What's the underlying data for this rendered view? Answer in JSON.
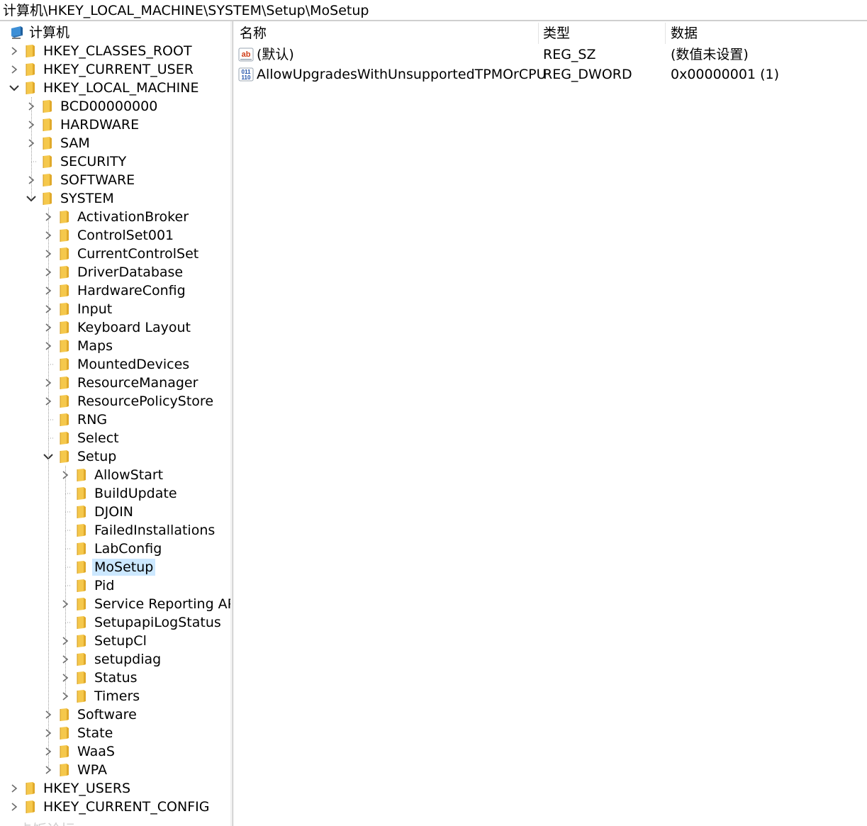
{
  "address_bar": {
    "path": "计算机\\HKEY_LOCAL_MACHINE\\SYSTEM\\Setup\\MoSetup"
  },
  "tree": {
    "root_label": "计算机",
    "items": [
      {
        "label": "HKEY_CLASSES_ROOT",
        "level": 1,
        "expander": "collapsed"
      },
      {
        "label": "HKEY_CURRENT_USER",
        "level": 1,
        "expander": "collapsed"
      },
      {
        "label": "HKEY_LOCAL_MACHINE",
        "level": 1,
        "expander": "expanded"
      },
      {
        "label": "BCD00000000",
        "level": 2,
        "expander": "collapsed"
      },
      {
        "label": "HARDWARE",
        "level": 2,
        "expander": "collapsed"
      },
      {
        "label": "SAM",
        "level": 2,
        "expander": "collapsed"
      },
      {
        "label": "SECURITY",
        "level": 2,
        "expander": "none"
      },
      {
        "label": "SOFTWARE",
        "level": 2,
        "expander": "collapsed"
      },
      {
        "label": "SYSTEM",
        "level": 2,
        "expander": "expanded"
      },
      {
        "label": "ActivationBroker",
        "level": 3,
        "expander": "collapsed"
      },
      {
        "label": "ControlSet001",
        "level": 3,
        "expander": "collapsed"
      },
      {
        "label": "CurrentControlSet",
        "level": 3,
        "expander": "collapsed"
      },
      {
        "label": "DriverDatabase",
        "level": 3,
        "expander": "collapsed"
      },
      {
        "label": "HardwareConfig",
        "level": 3,
        "expander": "collapsed"
      },
      {
        "label": "Input",
        "level": 3,
        "expander": "collapsed"
      },
      {
        "label": "Keyboard Layout",
        "level": 3,
        "expander": "collapsed"
      },
      {
        "label": "Maps",
        "level": 3,
        "expander": "collapsed"
      },
      {
        "label": "MountedDevices",
        "level": 3,
        "expander": "none"
      },
      {
        "label": "ResourceManager",
        "level": 3,
        "expander": "collapsed"
      },
      {
        "label": "ResourcePolicyStore",
        "level": 3,
        "expander": "collapsed"
      },
      {
        "label": "RNG",
        "level": 3,
        "expander": "none"
      },
      {
        "label": "Select",
        "level": 3,
        "expander": "none"
      },
      {
        "label": "Setup",
        "level": 3,
        "expander": "expanded"
      },
      {
        "label": "AllowStart",
        "level": 4,
        "expander": "collapsed"
      },
      {
        "label": "BuildUpdate",
        "level": 4,
        "expander": "none"
      },
      {
        "label": "DJOIN",
        "level": 4,
        "expander": "none"
      },
      {
        "label": "FailedInstallations",
        "level": 4,
        "expander": "none"
      },
      {
        "label": "LabConfig",
        "level": 4,
        "expander": "none"
      },
      {
        "label": "MoSetup",
        "level": 4,
        "expander": "none",
        "selected": true
      },
      {
        "label": "Pid",
        "level": 4,
        "expander": "none"
      },
      {
        "label": "Service Reporting API",
        "level": 4,
        "expander": "collapsed"
      },
      {
        "label": "SetupapiLogStatus",
        "level": 4,
        "expander": "none"
      },
      {
        "label": "SetupCl",
        "level": 4,
        "expander": "collapsed"
      },
      {
        "label": "setupdiag",
        "level": 4,
        "expander": "collapsed"
      },
      {
        "label": "Status",
        "level": 4,
        "expander": "collapsed"
      },
      {
        "label": "Timers",
        "level": 4,
        "expander": "collapsed"
      },
      {
        "label": "Software",
        "level": 3,
        "expander": "collapsed"
      },
      {
        "label": "State",
        "level": 3,
        "expander": "collapsed"
      },
      {
        "label": "WaaS",
        "level": 3,
        "expander": "collapsed"
      },
      {
        "label": "WPA",
        "level": 3,
        "expander": "collapsed"
      },
      {
        "label": "HKEY_USERS",
        "level": 1,
        "expander": "collapsed"
      },
      {
        "label": "HKEY_CURRENT_CONFIG",
        "level": 1,
        "expander": "collapsed"
      }
    ]
  },
  "list": {
    "columns": {
      "name": "名称",
      "type": "类型",
      "data": "数据"
    },
    "rows": [
      {
        "icon": "string-value-icon",
        "name": "(默认)",
        "type": "REG_SZ",
        "data": "(数值未设置)"
      },
      {
        "icon": "binary-value-icon",
        "name": "AllowUpgradesWithUnsupportedTPMOrCPU",
        "type": "REG_DWORD",
        "data": "0x00000001 (1)"
      }
    ]
  },
  "watermark": "卡饭论坛",
  "colors": {
    "selection": "#cce8ff",
    "folder": "#f5c84c",
    "chevron": "#6b6b6b"
  }
}
